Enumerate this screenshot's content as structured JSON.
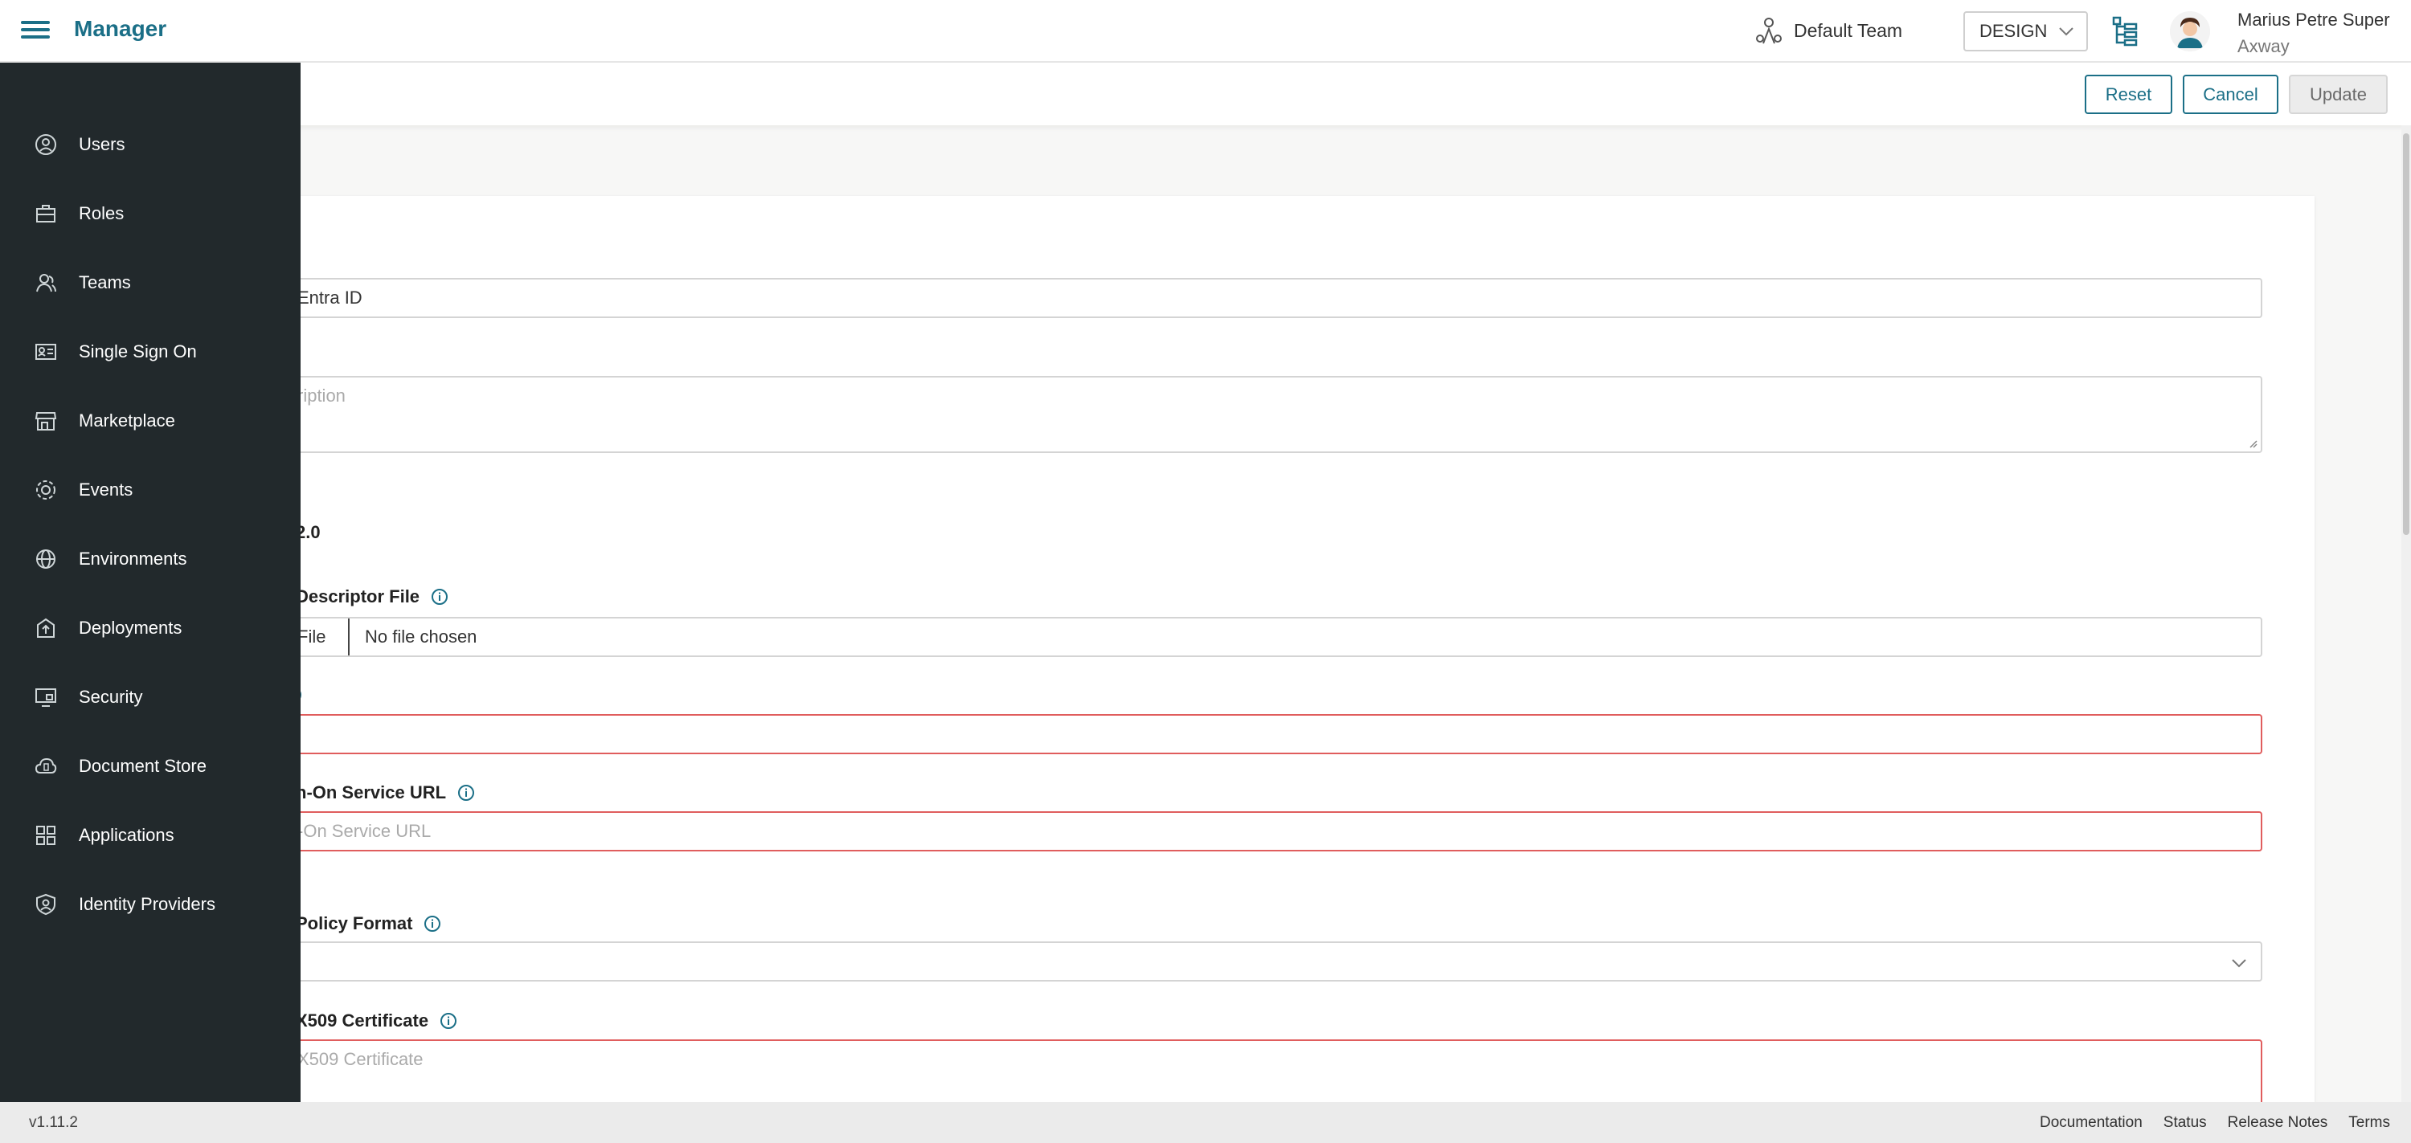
{
  "header": {
    "app_title": "Manager",
    "team_label": "Default Team",
    "environment": "DESIGN",
    "user_name": "Marius Petre Super",
    "user_org": "Axway"
  },
  "actions": {
    "reset": "Reset",
    "cancel": "Cancel",
    "update": "Update"
  },
  "sidebar": {
    "items": [
      {
        "label": "Users",
        "icon": "user-icon"
      },
      {
        "label": "Roles",
        "icon": "briefcase-icon"
      },
      {
        "label": "Teams",
        "icon": "team-icon"
      },
      {
        "label": "Single Sign On",
        "icon": "id-card-icon"
      },
      {
        "label": "Marketplace",
        "icon": "store-icon"
      },
      {
        "label": "Events",
        "icon": "gear-icon"
      },
      {
        "label": "Environments",
        "icon": "globe-icon"
      },
      {
        "label": "Deployments",
        "icon": "deploy-icon"
      },
      {
        "label": "Security",
        "icon": "monitor-lock-icon"
      },
      {
        "label": "Document Store",
        "icon": "cloud-doc-icon"
      },
      {
        "label": "Applications",
        "icon": "apps-icon"
      },
      {
        "label": "Identity Providers",
        "icon": "shield-user-icon"
      }
    ]
  },
  "form": {
    "name_value": "Entra ID",
    "description_placeholder": "ription",
    "version_value": "2.0",
    "descriptor_label": "Descriptor File",
    "file_button": "File",
    "file_status": "No file chosen",
    "sso_url_label": "n-On Service URL",
    "sso_url_placeholder": "-On Service URL",
    "policy_label": "Policy Format",
    "x509_label": "X509 Certificate",
    "x509_placeholder": "X509 Certificate"
  },
  "footer": {
    "version": "v1.11.2",
    "links": [
      "Documentation",
      "Status",
      "Release Notes",
      "Terms"
    ]
  },
  "colors": {
    "brand": "#1b6f87",
    "sidebar_bg": "#22292c",
    "error_border": "#e05d5d"
  }
}
